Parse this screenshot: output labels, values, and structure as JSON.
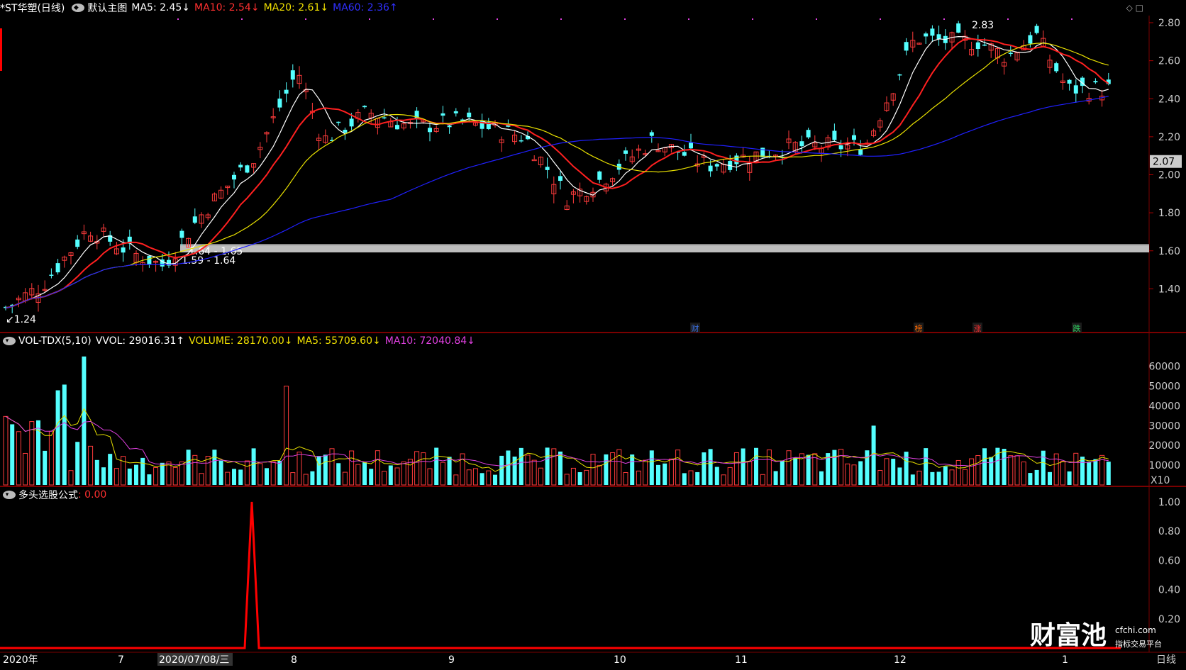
{
  "header": {
    "stock": "*ST华塑(日线)",
    "template": "默认主图",
    "ma5": "MA5: 2.45↓",
    "ma10": "MA10: 2.54↓",
    "ma20": "MA20: 2.61↓",
    "ma60": "MA60: 2.36↑"
  },
  "vol_header": {
    "name": "VOL-TDX(5,10)",
    "vvol": "VVOL: 29016.31↑",
    "volume": "VOLUME: 28170.00↓",
    "ma5": "MA5: 55709.60↓",
    "ma10": "MA10: 72040.84↓"
  },
  "ind_header": {
    "name": "多头选股公式",
    "value": ": 0.00"
  },
  "price_axis": [
    "2.80",
    "2.60",
    "2.40",
    "2.20",
    "2.00",
    "1.80",
    "1.60",
    "1.40"
  ],
  "current_price": "2.07",
  "vol_axis": [
    "60000",
    "50000",
    "40000",
    "30000",
    "20000",
    "10000"
  ],
  "vol_unit": "X10",
  "ind_axis": [
    "1.00",
    "0.80",
    "0.60",
    "0.40",
    "0.20"
  ],
  "x_labels": [
    {
      "t": "2020年"
    },
    {
      "t": "7"
    },
    {
      "t": "2020/07/08/三"
    },
    {
      "t": "8"
    },
    {
      "t": "9"
    },
    {
      "t": "10"
    },
    {
      "t": "11"
    },
    {
      "t": "12"
    },
    {
      "t": "1"
    }
  ],
  "period_label": "日线",
  "annotations": {
    "high": "2.83",
    "low": "1.24",
    "band1": "1.64 - 1.65",
    "band2": "1.59 - 1.64"
  },
  "markers": [
    "财",
    "榜",
    "涨",
    "跌"
  ],
  "brand": {
    "name": "财富池",
    "site": "cfchi.com",
    "slogan": "指标交易平台"
  },
  "colors": {
    "up": "#ff3b3b",
    "down": "#54ffff",
    "ma5": "#ffffff",
    "ma10": "#ff2020",
    "ma20": "#e8e000",
    "ma60": "#2020ff"
  }
}
